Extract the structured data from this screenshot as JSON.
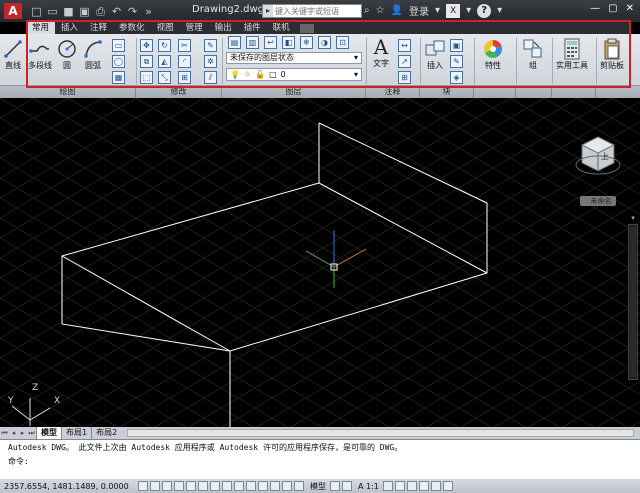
{
  "titlebar": {
    "app_letter": "A",
    "doc_title": "Drawing2.dwg",
    "search_placeholder": "键入关键字或短语",
    "login_label": "登录",
    "help_label": "?"
  },
  "tabs": [
    {
      "label": "常用",
      "active": true
    },
    {
      "label": "插入",
      "active": false
    },
    {
      "label": "注释",
      "active": false
    },
    {
      "label": "参数化",
      "active": false
    },
    {
      "label": "视图",
      "active": false
    },
    {
      "label": "管理",
      "active": false
    },
    {
      "label": "输出",
      "active": false
    },
    {
      "label": "插件",
      "active": false
    },
    {
      "label": "联机",
      "active": false
    }
  ],
  "ribbon": {
    "draw": {
      "line": "直线",
      "polyline": "多段线",
      "circle": "圆",
      "arc": "圆弧"
    },
    "layer_state": "未保存的图层状态",
    "layer_current": "0",
    "annotation": {
      "text": "文字"
    },
    "block": {
      "insert": "插入"
    },
    "properties": "特性",
    "group": "组",
    "utilities": "实用工具",
    "clipboard": "剪贴板"
  },
  "panel_titles": [
    "绘图",
    "修改",
    "图层",
    "注释",
    "块",
    "",
    "",
    "",
    "",
    ""
  ],
  "viewcube": {
    "top_label": "上",
    "home_label": "未命名"
  },
  "ucs": {
    "x": "X",
    "y": "Y",
    "z": "Z"
  },
  "layout_tabs": [
    {
      "label": "模型",
      "active": true
    },
    {
      "label": "布局1",
      "active": false
    },
    {
      "label": "布局2",
      "active": false
    }
  ],
  "command": {
    "history": "Autodesk DWG。  此文件上次由 Autodesk 应用程序或 Autodesk 许可的应用程序保存，是可靠的 DWG。",
    "prompt": "命令:"
  },
  "status": {
    "coords": "2357.6554, 1481.1489, 0.0000",
    "model_label": "模型",
    "scale_label": "A 1:1"
  },
  "colors": {
    "accent_frame": "#d21f26",
    "viewport_bg": "#000000",
    "box_stroke": "#ffffff"
  }
}
